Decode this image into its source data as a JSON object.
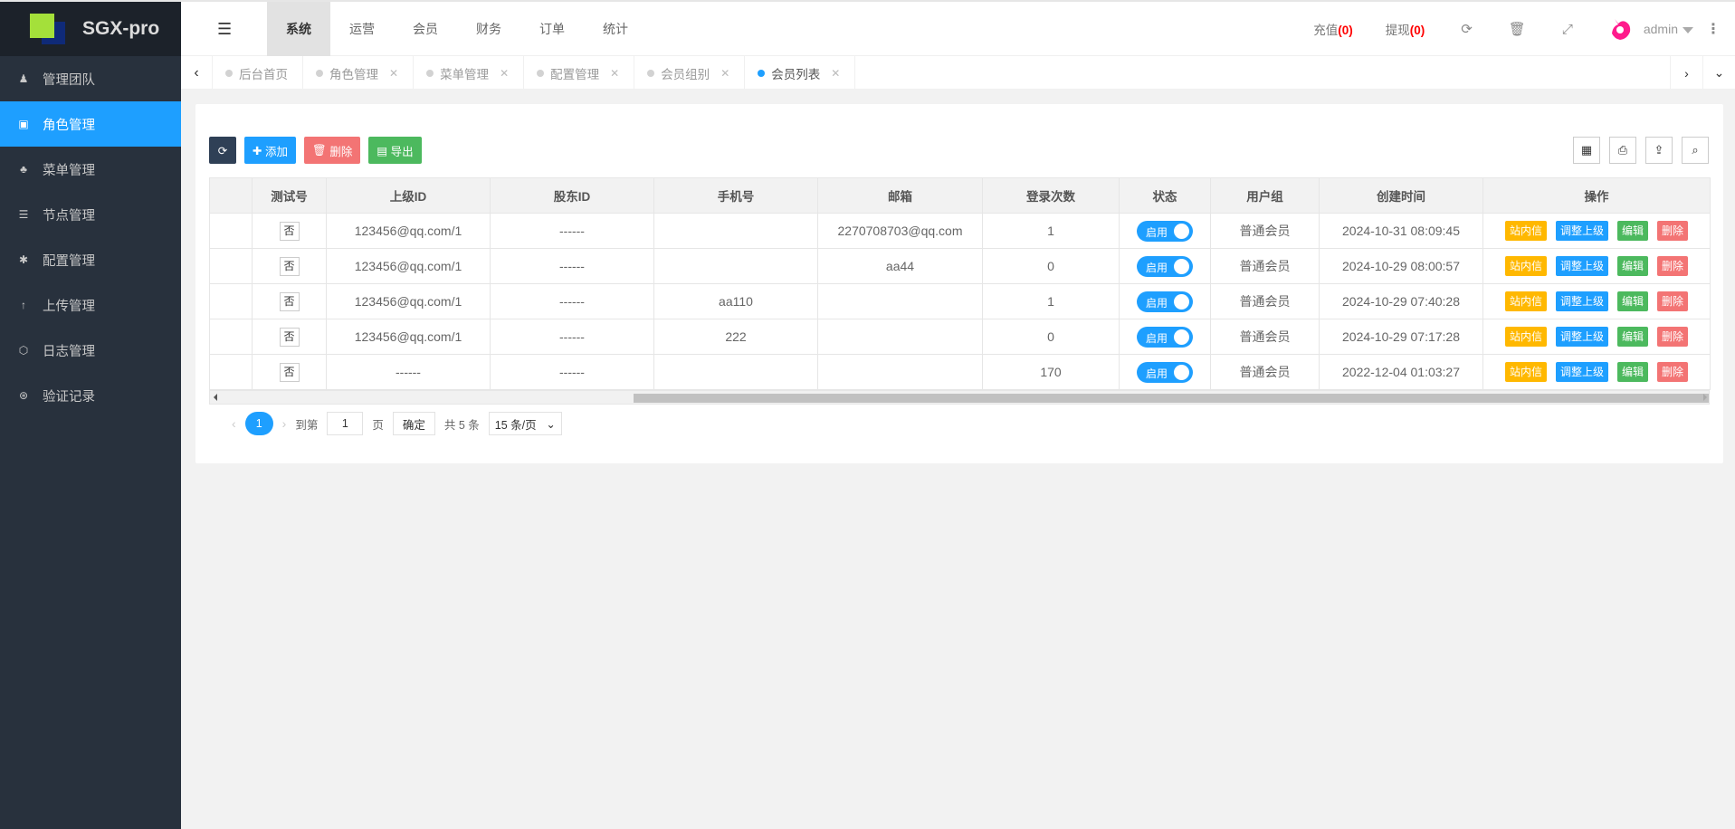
{
  "app": {
    "name": "SGX-pro",
    "logo_colors": {
      "front": "#a4e03a",
      "back": "#0f2a78"
    }
  },
  "sidebar": {
    "items": [
      {
        "label": "管理团队",
        "icon": "user-icon",
        "glyph": "♟"
      },
      {
        "label": "角色管理",
        "icon": "role-icon",
        "glyph": "▣",
        "active": true
      },
      {
        "label": "菜单管理",
        "icon": "tree-icon",
        "glyph": "♣"
      },
      {
        "label": "节点管理",
        "icon": "list-icon",
        "glyph": "☰"
      },
      {
        "label": "配置管理",
        "icon": "asterisk-icon",
        "glyph": "✱"
      },
      {
        "label": "上传管理",
        "icon": "arrow-up-icon",
        "glyph": "↑"
      },
      {
        "label": "日志管理",
        "icon": "hexagon-icon",
        "glyph": "⬡"
      },
      {
        "label": "验证记录",
        "icon": "codepen-icon",
        "glyph": "⊛"
      }
    ]
  },
  "topbar": {
    "menus": [
      "系统",
      "运营",
      "会员",
      "财务",
      "订单",
      "统计"
    ],
    "active_menu": "系统",
    "recharge_label": "充值",
    "recharge_count": "(0)",
    "withdraw_label": "提现",
    "withdraw_count": "(0)",
    "user": "admin"
  },
  "tabs": [
    {
      "label": "后台首页",
      "closable": false
    },
    {
      "label": "角色管理",
      "closable": true
    },
    {
      "label": "菜单管理",
      "closable": true
    },
    {
      "label": "配置管理",
      "closable": true
    },
    {
      "label": "会员组别",
      "closable": true
    },
    {
      "label": "会员列表",
      "closable": true,
      "active": true
    }
  ],
  "toolbar": {
    "add": "添加",
    "delete": "删除",
    "export": "导出"
  },
  "table": {
    "columns": [
      "",
      "测试号",
      "上级ID",
      "股东ID",
      "手机号",
      "邮箱",
      "登录次数",
      "状态",
      "用户组",
      "创建时间",
      "操作"
    ],
    "rows": [
      {
        "test": "否",
        "parent": "123456@qq.com/1",
        "shareholder": "------",
        "phone": "",
        "email": "2270708703@qq.com",
        "logins": "1",
        "status": "启用",
        "group": "普通会员",
        "created": "2024-10-31 08:09:45"
      },
      {
        "test": "否",
        "parent": "123456@qq.com/1",
        "shareholder": "------",
        "phone": "",
        "email": "aa44",
        "logins": "0",
        "status": "启用",
        "group": "普通会员",
        "created": "2024-10-29 08:00:57"
      },
      {
        "test": "否",
        "parent": "123456@qq.com/1",
        "shareholder": "------",
        "phone": "aa110",
        "email": "",
        "logins": "1",
        "status": "启用",
        "group": "普通会员",
        "created": "2024-10-29 07:40:28"
      },
      {
        "test": "否",
        "parent": "123456@qq.com/1",
        "shareholder": "------",
        "phone": "222",
        "email": "",
        "logins": "0",
        "status": "启用",
        "group": "普通会员",
        "created": "2024-10-29 07:17:28"
      },
      {
        "test": "否",
        "parent": "------",
        "shareholder": "------",
        "phone": "",
        "email": "",
        "logins": "170",
        "status": "启用",
        "group": "普通会员",
        "created": "2022-12-04 01:03:27"
      }
    ],
    "actions": [
      "站内信",
      "调整上级",
      "编辑",
      "删除"
    ]
  },
  "pager": {
    "current": "1",
    "goto_label": "到第",
    "goto_value": "1",
    "page_label": "页",
    "confirm": "确定",
    "total": "共 5 条",
    "per_page": "15 条/页"
  }
}
